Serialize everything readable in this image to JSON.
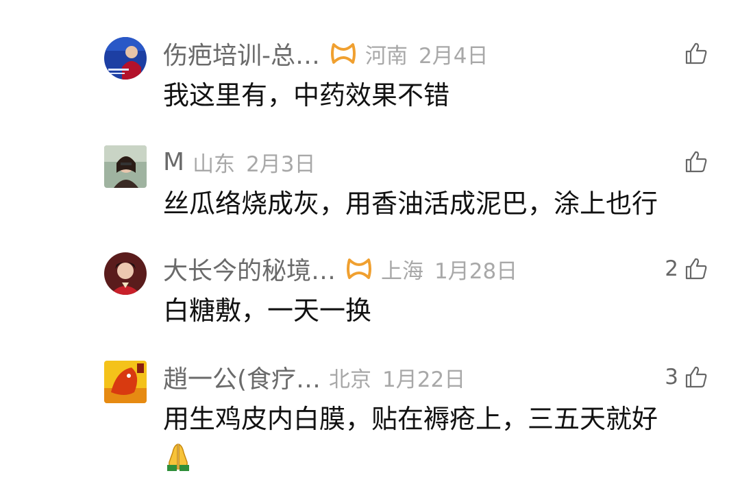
{
  "comments": [
    {
      "username": "伤疤培训-总…",
      "location": "河南",
      "date": "2月4日",
      "likes": "",
      "text": "我这里有，中药效果不错",
      "has_badge": true
    },
    {
      "username": "M",
      "location": "山东",
      "date": "2月3日",
      "likes": "",
      "text": "丝瓜络烧成灰，用香油活成泥巴，涂上也行",
      "has_badge": false
    },
    {
      "username": "大长今的秘境…",
      "location": "上海",
      "date": "1月28日",
      "likes": "2",
      "text": "白糖敷，一天一换",
      "has_badge": true
    },
    {
      "username": "趙一公(食疗…",
      "location": "北京",
      "date": "1月22日",
      "likes": "3",
      "text": "用生鸡皮内白膜，贴在褥疮上，三五天就好",
      "has_badge": false
    }
  ],
  "icons": {
    "like": "thumbs-up-icon",
    "badge": "orange-ribbon-badge-icon",
    "emoji": "folded-hands-icon"
  },
  "colors": {
    "username": "#6a6a6a",
    "meta": "#a8a8a8",
    "text": "#111111",
    "badge": "#f0a030"
  }
}
